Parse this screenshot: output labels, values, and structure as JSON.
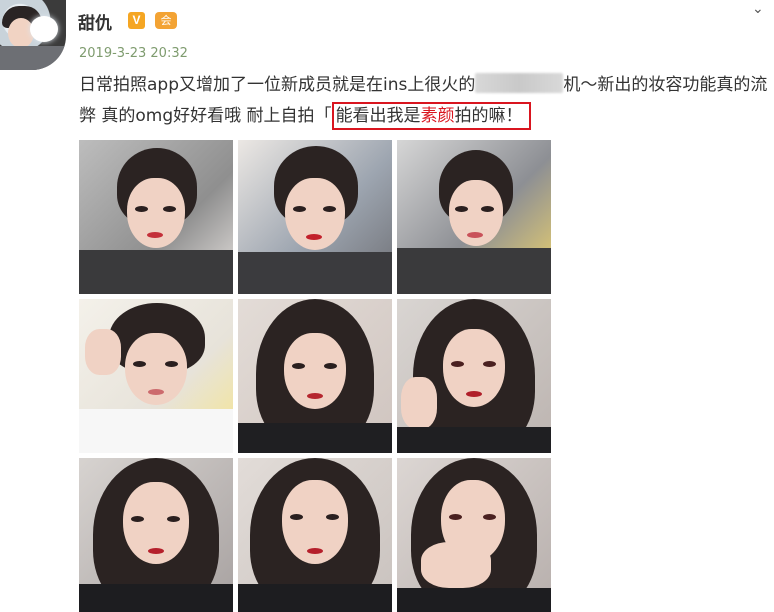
{
  "post": {
    "author": "甜仇",
    "verified_badge": "V",
    "member_badge": "会",
    "timestamp": "2019-3-23 20:32",
    "text_part1": "日常拍照app又增加了一位新成员就是在ins上很火的",
    "text_part2": "机～新出的妆容功能真的流弊 真的omg好好看哦 耐上自拍",
    "text_part3": "「",
    "highlight_before": "能看出我是",
    "highlight_red": "素颜",
    "highlight_after": "拍的嘛！"
  },
  "icons": {
    "menu": "chevron-down-icon",
    "verified": "verified-v-icon",
    "member": "crown-member-icon"
  },
  "colors": {
    "timestamp": "#7e9b6e",
    "highlight": "#d9151f",
    "text": "#333333"
  },
  "photos": [
    {
      "label": "selfie-1"
    },
    {
      "label": "selfie-2"
    },
    {
      "label": "selfie-3"
    },
    {
      "label": "selfie-4"
    },
    {
      "label": "selfie-5"
    },
    {
      "label": "selfie-6"
    },
    {
      "label": "selfie-7"
    },
    {
      "label": "selfie-8"
    },
    {
      "label": "selfie-9"
    }
  ]
}
